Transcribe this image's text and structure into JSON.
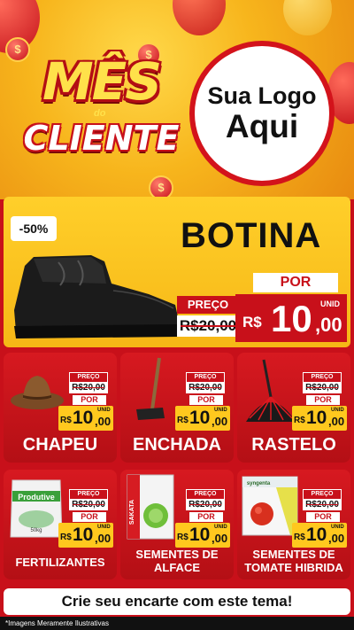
{
  "header": {
    "campaign_top": "MÊS",
    "campaign_small": "do",
    "campaign_bottom": "CLIENTE",
    "coin_symbol": "$",
    "logo_line1": "Sua Logo",
    "logo_line2": "Aqui"
  },
  "hero": {
    "discount": "-50%",
    "title": "BOTINA",
    "preco_label": "PREÇO",
    "old_price": "R$20,00",
    "por_label": "POR",
    "currency": "R$",
    "price_int": "10",
    "price_cents": ",00",
    "unit": "UNID"
  },
  "products": [
    {
      "name": "CHAPEU",
      "preco_label": "PREÇO",
      "old_price": "R$20,00",
      "por_label": "POR",
      "currency": "R$",
      "price_int": "10",
      "price_cents": ",00",
      "unit": "UNID"
    },
    {
      "name": "ENCHADA",
      "preco_label": "PREÇO",
      "old_price": "R$20,00",
      "por_label": "POR",
      "currency": "R$",
      "price_int": "10",
      "price_cents": ",00",
      "unit": "UNID"
    },
    {
      "name": "RASTELO",
      "preco_label": "PREÇO",
      "old_price": "R$20,00",
      "por_label": "POR",
      "currency": "R$",
      "price_int": "10",
      "price_cents": ",00",
      "unit": "UNID"
    },
    {
      "name": "FERTILIZANTES",
      "package_text": "Produtive",
      "package_weight": "50kg",
      "preco_label": "PREÇO",
      "old_price": "R$20,00",
      "por_label": "POR",
      "currency": "R$",
      "price_int": "10",
      "price_cents": ",00",
      "unit": "UNID"
    },
    {
      "name_line1": "SEMENTES DE",
      "name_line2": "ALFACE",
      "package_text": "SAKATA",
      "preco_label": "PREÇO",
      "old_price": "R$20,00",
      "por_label": "POR",
      "currency": "R$",
      "price_int": "10",
      "price_cents": ",00",
      "unit": "UNID"
    },
    {
      "name_line1": "SEMENTES DE",
      "name_line2": "TOMATE HIBRIDA",
      "package_text": "syngenta",
      "preco_label": "PREÇO",
      "old_price": "R$20,00",
      "por_label": "POR",
      "currency": "R$",
      "price_int": "10",
      "price_cents": ",00",
      "unit": "UNID"
    }
  ],
  "footer": {
    "cta": "Crie seu encarte com este tema!",
    "disclaimer": "*Imagens Meramente Ilustrativas"
  },
  "colors": {
    "primary_red": "#c8101a",
    "accent_yellow": "#ffc81e"
  }
}
